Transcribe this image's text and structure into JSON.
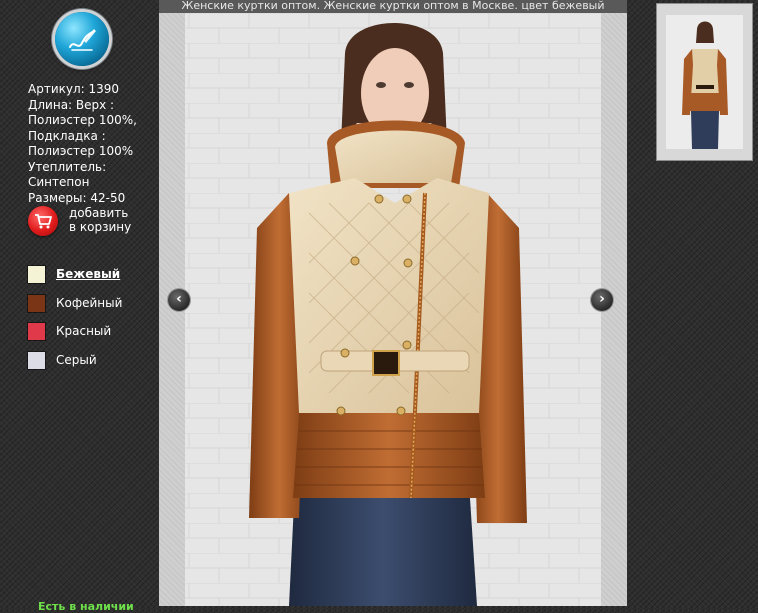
{
  "logo": {
    "icon": "pen-signature-icon"
  },
  "product": {
    "article": "Артикул: 1390",
    "length": "Длина: Верх :\nПолиэстер 100%,",
    "lining": "Подкладка :\nПолиэстер 100%",
    "insulation": "Утеплитель:\nСинтепон",
    "sizes": "Размеры: 42-50"
  },
  "cart": {
    "icon": "shopping-cart-icon",
    "label": "добавить\nв корзину"
  },
  "colors": [
    {
      "name": "Бежевый",
      "swatch": "#f5f3d6",
      "active": true
    },
    {
      "name": "Кофейный",
      "swatch": "#7a3416",
      "active": false
    },
    {
      "name": "Красный",
      "swatch": "#e0394a",
      "active": false
    },
    {
      "name": "Серый",
      "swatch": "#dcdce6",
      "active": false
    }
  ],
  "main": {
    "title": "Женские куртки оптом. Женские куртки оптом в Москве. цвет бежевый",
    "prev_icon": "chevron-left-icon",
    "next_icon": "chevron-right-icon",
    "prev_glyph": "‹",
    "next_glyph": "›"
  },
  "stock": "Есть в наличии",
  "palette": {
    "jacket_beige": "#e6d3b0",
    "jacket_brown": "#a85a26",
    "jeans": "#2c3a55",
    "wall": "#e4e4e4"
  }
}
